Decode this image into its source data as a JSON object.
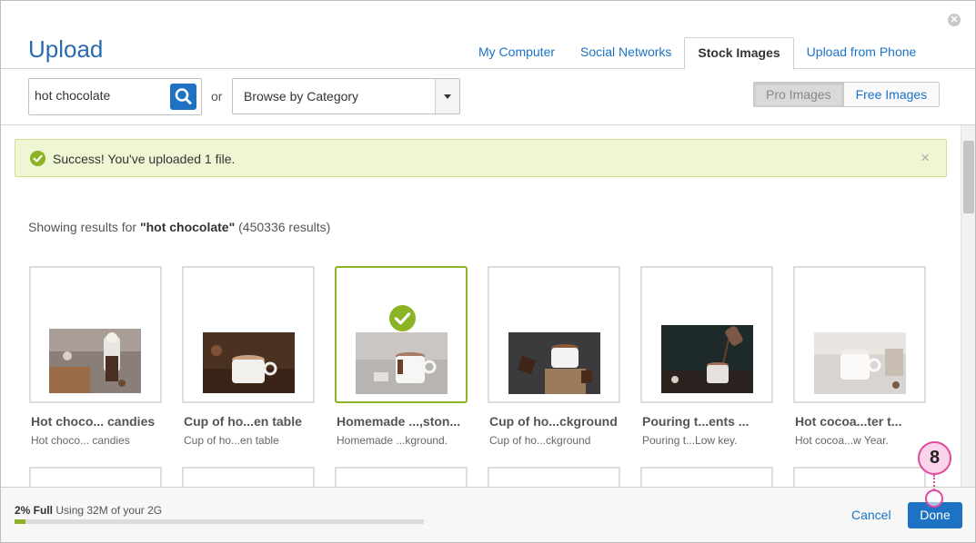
{
  "dialog": {
    "title": "Upload",
    "close_icon": "close-x-icon"
  },
  "tabs": [
    {
      "label": "My Computer",
      "active": false
    },
    {
      "label": "Social Networks",
      "active": false
    },
    {
      "label": "Stock Images",
      "active": true
    },
    {
      "label": "Upload from Phone",
      "active": false
    }
  ],
  "search": {
    "value": "hot chocolate",
    "icon": "search-icon",
    "or_label": "or",
    "category_label": "Browse by Category"
  },
  "filter": {
    "pro_label": "Pro Images",
    "free_label": "Free Images",
    "selected": "Pro Images"
  },
  "alert": {
    "message": "Success! You've uploaded 1 file.",
    "icon": "check-circle-icon",
    "close": "×"
  },
  "results": {
    "prefix": "Showing results for",
    "query": "\"hot chocolate\"",
    "count": "(450336 results)"
  },
  "images": [
    {
      "title": "Hot choco... candies",
      "subtitle": "Hot choco... candies",
      "selected": false
    },
    {
      "title": "Cup of ho...en table",
      "subtitle": "Cup of ho...en table",
      "selected": false
    },
    {
      "title": "Homemade ...,ston...",
      "subtitle": "Homemade ...kground.",
      "selected": true
    },
    {
      "title": "Cup of ho...ckground",
      "subtitle": "Cup of ho...ckground",
      "selected": false
    },
    {
      "title": "Pouring t...ents ...",
      "subtitle": "Pouring t...Low key.",
      "selected": false
    },
    {
      "title": "Hot cocoa...ter t...",
      "subtitle": "Hot cocoa...w Year.",
      "selected": false
    }
  ],
  "footer": {
    "usage_percent_label": "2% Full",
    "usage_text": "Using 32M of your 2G",
    "usage_fraction": 0.02,
    "cancel_label": "Cancel",
    "done_label": "Done"
  },
  "annotation": {
    "step": "8"
  },
  "colors": {
    "accent_blue": "#1d72c3",
    "success_green": "#8bb324",
    "annotation_pink": "#e14a9d"
  }
}
